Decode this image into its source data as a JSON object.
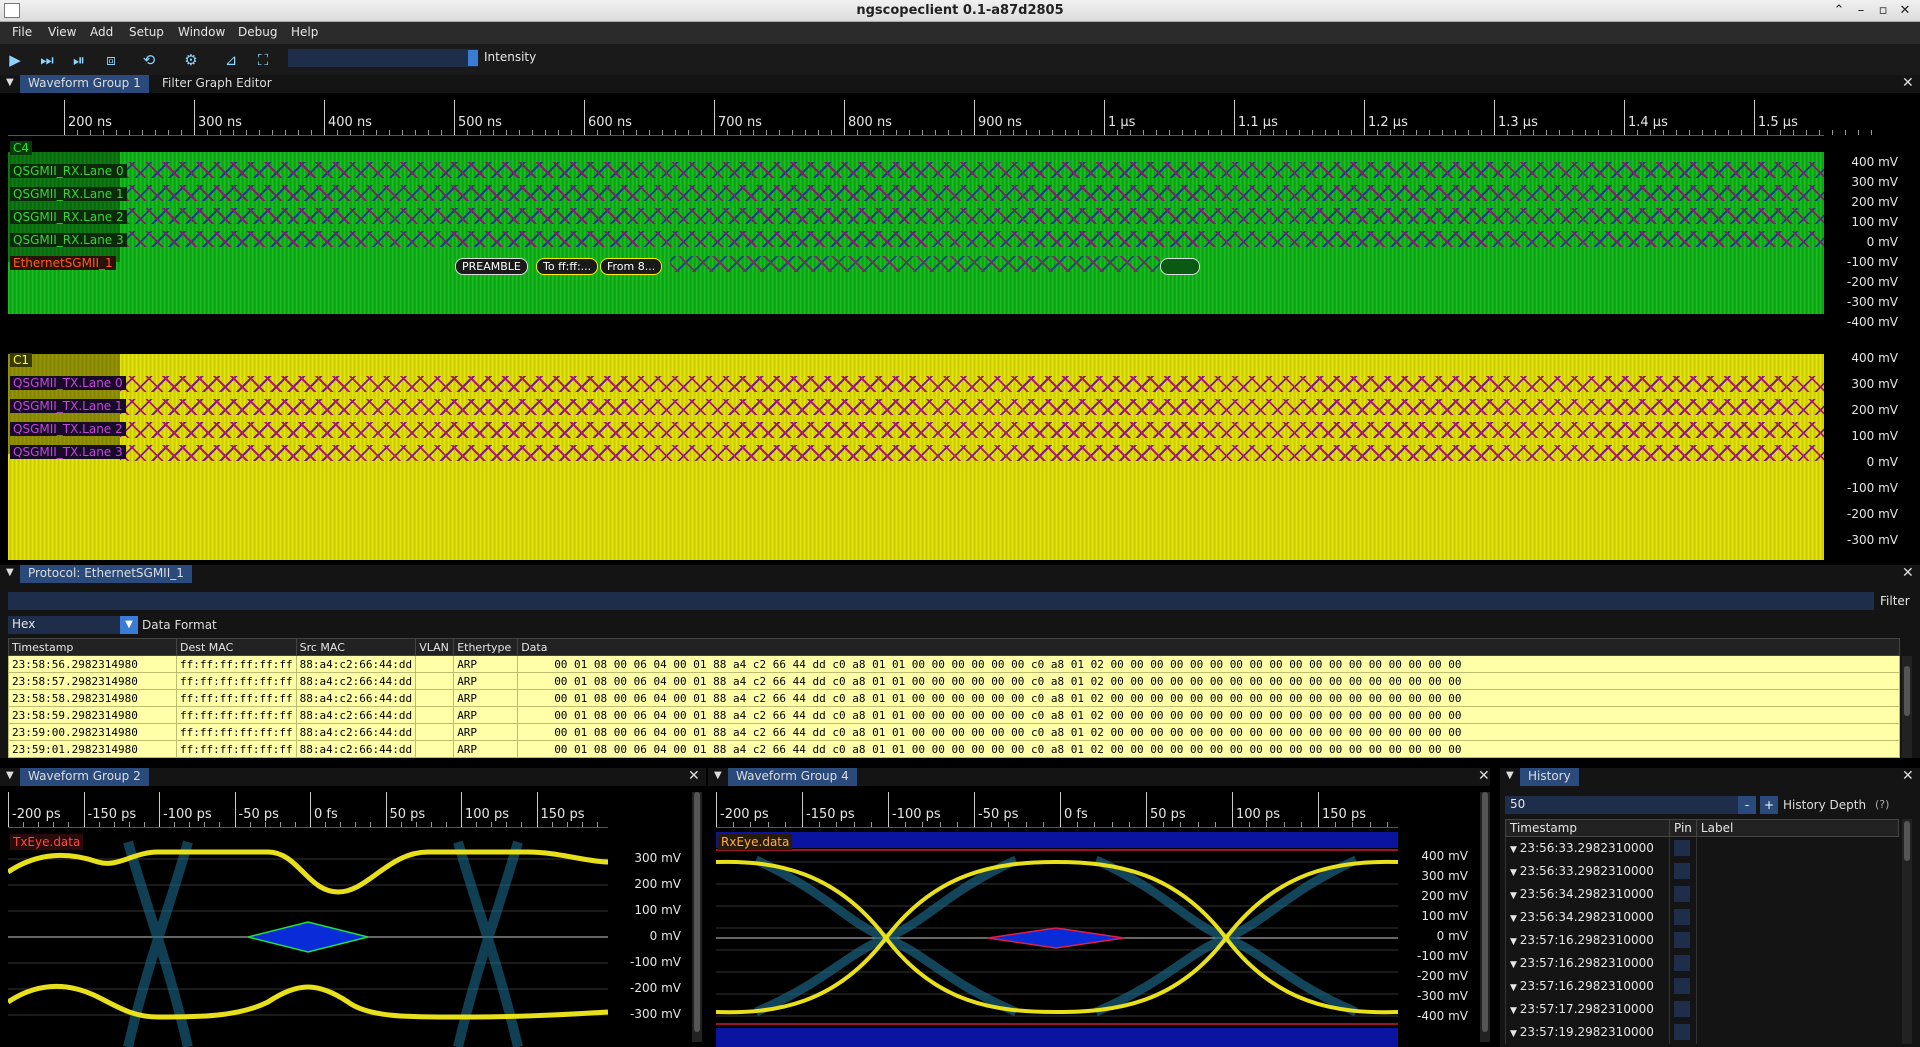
{
  "window": {
    "title": "ngscopeclient 0.1-a87d2805"
  },
  "menu": [
    "File",
    "View",
    "Add",
    "Setup",
    "Window",
    "Debug",
    "Help"
  ],
  "toolbar": {
    "intensity_label": "Intensity"
  },
  "tabs_main": [
    {
      "label": "Waveform Group 1"
    },
    {
      "label": "Filter Graph Editor"
    }
  ],
  "timeline_top": [
    "200 ns",
    "300 ns",
    "400 ns",
    "500 ns",
    "600 ns",
    "700 ns",
    "800 ns",
    "900 ns",
    "1 µs",
    "1.1 µs",
    "1.2 µs",
    "1.3 µs",
    "1.4 µs",
    "1.5 µs"
  ],
  "rx_plot": {
    "channel": "C4",
    "lanes": [
      "QSGMII_RX.Lane 0",
      "QSGMII_RX.Lane 1",
      "QSGMII_RX.Lane 2",
      "QSGMII_RX.Lane 3"
    ],
    "ethernet": "EthernetSGMII_1",
    "y_labels": [
      "400 mV",
      "300 mV",
      "200 mV",
      "100 mV",
      "0 mV",
      "-100 mV",
      "-200 mV",
      "-300 mV",
      "-400 mV"
    ],
    "packet_tags": [
      "PREAMBLE",
      "To ff:ff:...",
      "From 8..."
    ]
  },
  "tx_plot": {
    "channel": "C1",
    "lanes": [
      "QSGMII_TX.Lane 0",
      "QSGMII_TX.Lane 1",
      "QSGMII_TX.Lane 2",
      "QSGMII_TX.Lane 3"
    ],
    "y_labels": [
      "400 mV",
      "300 mV",
      "200 mV",
      "100 mV",
      "0 mV",
      "-100 mV",
      "-200 mV",
      "-300 mV"
    ]
  },
  "protocol": {
    "tab": "Protocol: EthernetSGMII_1",
    "filter_label": "Filter",
    "format_value": "Hex",
    "format_label": "Data Format",
    "columns": [
      "Timestamp",
      "Dest MAC",
      "Src MAC",
      "VLAN",
      "Ethertype",
      "Data"
    ],
    "rows": [
      [
        "23:58:56.2982314980",
        "ff:ff:ff:ff:ff:ff",
        "88:a4:c2:66:44:dd",
        "",
        "ARP",
        "00 01 08 00 06 04 00 01 88 a4 c2 66 44 dd c0 a8 01 01 00 00 00 00 00 00 c0 a8 01 02 00 00 00 00 00 00 00 00 00 00 00 00 00 00 00 00 00 00"
      ],
      [
        "23:58:57.2982314980",
        "ff:ff:ff:ff:ff:ff",
        "88:a4:c2:66:44:dd",
        "",
        "ARP",
        "00 01 08 00 06 04 00 01 88 a4 c2 66 44 dd c0 a8 01 01 00 00 00 00 00 00 c0 a8 01 02 00 00 00 00 00 00 00 00 00 00 00 00 00 00 00 00 00 00"
      ],
      [
        "23:58:58.2982314980",
        "ff:ff:ff:ff:ff:ff",
        "88:a4:c2:66:44:dd",
        "",
        "ARP",
        "00 01 08 00 06 04 00 01 88 a4 c2 66 44 dd c0 a8 01 01 00 00 00 00 00 00 c0 a8 01 02 00 00 00 00 00 00 00 00 00 00 00 00 00 00 00 00 00 00"
      ],
      [
        "23:58:59.2982314980",
        "ff:ff:ff:ff:ff:ff",
        "88:a4:c2:66:44:dd",
        "",
        "ARP",
        "00 01 08 00 06 04 00 01 88 a4 c2 66 44 dd c0 a8 01 01 00 00 00 00 00 00 c0 a8 01 02 00 00 00 00 00 00 00 00 00 00 00 00 00 00 00 00 00 00"
      ],
      [
        "23:59:00.2982314980",
        "ff:ff:ff:ff:ff:ff",
        "88:a4:c2:66:44:dd",
        "",
        "ARP",
        "00 01 08 00 06 04 00 01 88 a4 c2 66 44 dd c0 a8 01 01 00 00 00 00 00 00 c0 a8 01 02 00 00 00 00 00 00 00 00 00 00 00 00 00 00 00 00 00 00"
      ],
      [
        "23:59:01.2982314980",
        "ff:ff:ff:ff:ff:ff",
        "88:a4:c2:66:44:dd",
        "",
        "ARP",
        "00 01 08 00 06 04 00 01 88 a4 c2 66 44 dd c0 a8 01 01 00 00 00 00 00 00 c0 a8 01 02 00 00 00 00 00 00 00 00 00 00 00 00 00 00 00 00 00 00"
      ]
    ]
  },
  "wg2": {
    "tab": "Waveform Group 2",
    "ticks": [
      "-200 ps",
      "-150 ps",
      "-100 ps",
      "-50 ps",
      "0 fs",
      "50 ps",
      "100 ps",
      "150 ps"
    ],
    "eye_label": "TxEye.data",
    "y_labels": [
      "300 mV",
      "200 mV",
      "100 mV",
      "0 mV",
      "-100 mV",
      "-200 mV",
      "-300 mV"
    ]
  },
  "wg4": {
    "tab": "Waveform Group 4",
    "ticks": [
      "-200 ps",
      "-150 ps",
      "-100 ps",
      "-50 ps",
      "0 fs",
      "50 ps",
      "100 ps",
      "150 ps"
    ],
    "eye_label": "RxEye.data",
    "y_labels": [
      "400 mV",
      "300 mV",
      "200 mV",
      "100 mV",
      "0 mV",
      "-100 mV",
      "-200 mV",
      "-300 mV",
      "-400 mV"
    ]
  },
  "history": {
    "tab": "History",
    "depth_value": "50",
    "minus": "-",
    "plus": "+",
    "depth_label": "History Depth",
    "help": "(?)",
    "columns": [
      "Timestamp",
      "Pin",
      "Label"
    ],
    "rows": [
      "23:56:33.2982310000",
      "23:56:33.2982310000",
      "23:56:34.2982310000",
      "23:56:34.2982310000",
      "23:57:16.2982310000",
      "23:57:16.2982310000",
      "23:57:16.2982310000",
      "23:57:17.2982310000",
      "23:57:19.2982310000"
    ]
  },
  "colors": {
    "rx_wave": "#19d21f",
    "tx_wave": "#ffff22",
    "accent": "#294a7a",
    "table_row": "#ffffa8"
  }
}
